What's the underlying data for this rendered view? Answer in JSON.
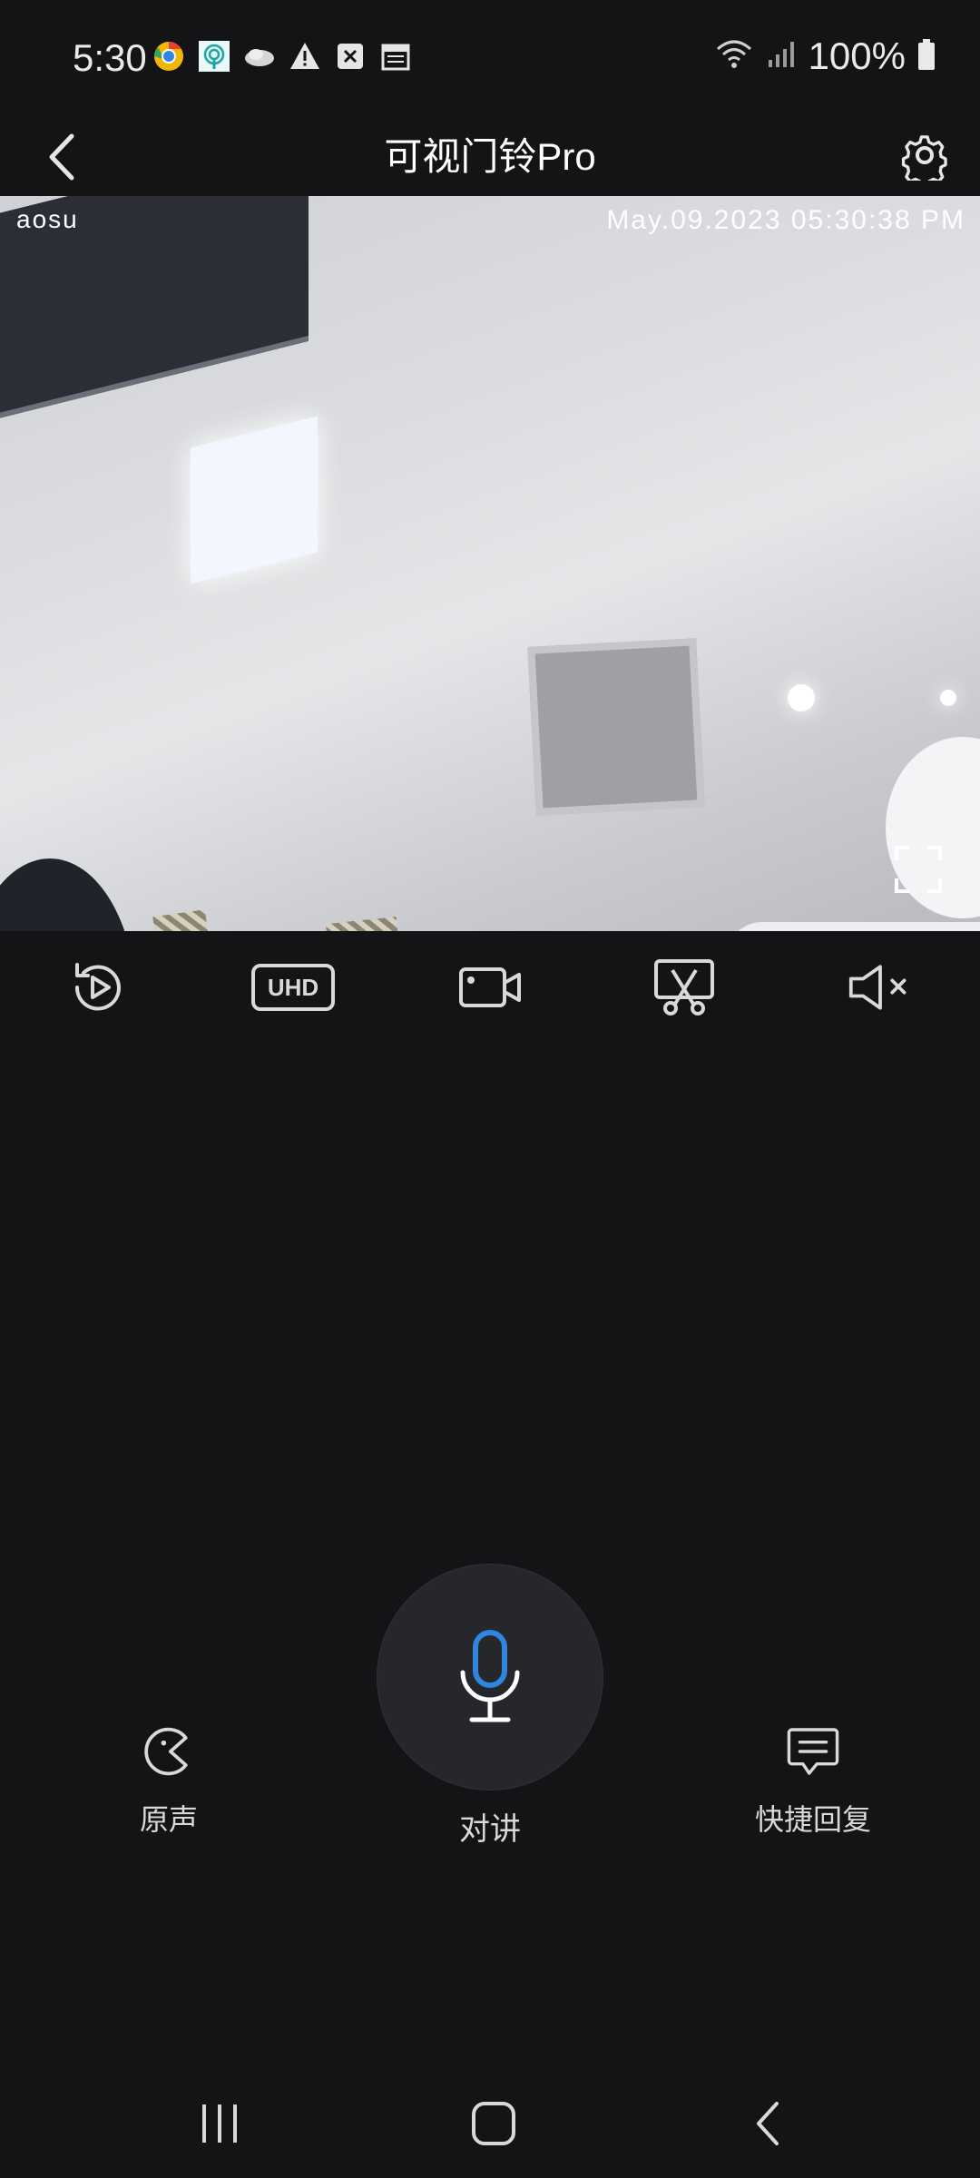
{
  "status_bar": {
    "time": "5:30",
    "battery": "100%",
    "notification_icons": [
      "chrome-icon",
      "hotspot-icon",
      "cloud-icon",
      "warning-icon",
      "close-box-icon",
      "calendar-icon"
    ],
    "right_icons": [
      "wifi-icon",
      "signal-icon",
      "battery-icon"
    ]
  },
  "header": {
    "title": "可视门铃Pro",
    "back_icon": "chevron-left-icon",
    "settings_icon": "gear-icon"
  },
  "video": {
    "brand": "aosu",
    "timestamp": "May.09.2023 05:30:38 PM",
    "fullscreen_icon": "fullscreen-icon"
  },
  "toolbar": {
    "items": [
      {
        "name": "playback",
        "icon": "replay-icon"
      },
      {
        "name": "quality",
        "icon": "uhd-icon",
        "label": "UHD"
      },
      {
        "name": "record",
        "icon": "video-camera-icon"
      },
      {
        "name": "screenshot",
        "icon": "scissors-icon"
      },
      {
        "name": "mute",
        "icon": "speaker-muted-icon"
      }
    ]
  },
  "controls": {
    "original_voice": {
      "label": "原声",
      "icon": "voice-change-icon"
    },
    "talk": {
      "label": "对讲",
      "icon": "microphone-icon"
    },
    "quick_reply": {
      "label": "快捷回复",
      "icon": "message-icon"
    }
  },
  "colors": {
    "background": "#141417",
    "accent_mic": "#2f86e0",
    "text": "#d9d9d9"
  },
  "nav_bar": {
    "items": [
      "recent-apps-icon",
      "home-icon",
      "back-icon"
    ]
  }
}
